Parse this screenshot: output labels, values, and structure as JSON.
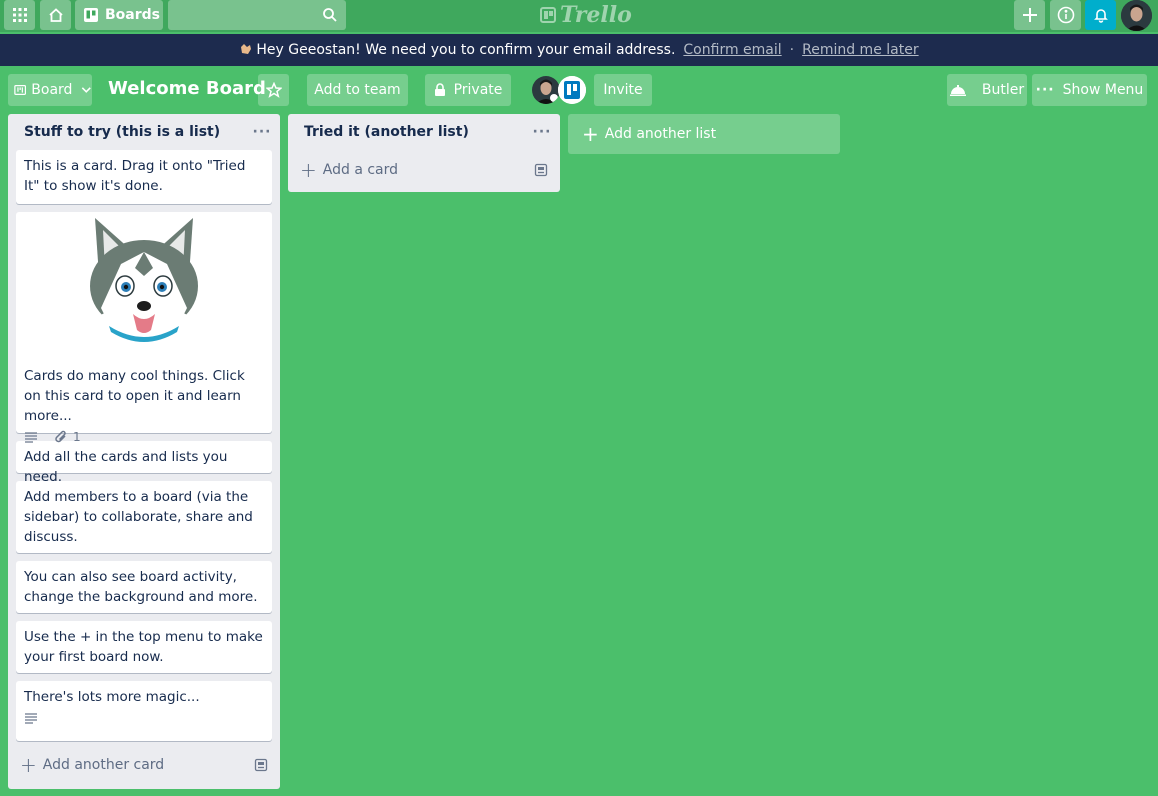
{
  "topbar": {
    "boards_label": "Boards",
    "logo_text": "Trello"
  },
  "banner": {
    "message": "Hey Geeostan! We need you to confirm your email address.",
    "confirm_link": "Confirm email",
    "separator": "·",
    "remind_link": "Remind me later"
  },
  "board_header": {
    "view_label": "Board",
    "title": "Welcome Board",
    "add_to_team": "Add to team",
    "visibility": "Private",
    "invite": "Invite",
    "butler": "Butler",
    "show_menu": "Show Menu"
  },
  "lists": [
    {
      "title": "Stuff to try (this is a list)",
      "menu": "···",
      "add_card": "Add another card",
      "cards": [
        {
          "text": "This is a card. Drag it onto \"Tried It\" to show it's done."
        },
        {
          "text": "Cards do many cool things. Click on this card to open it and learn more...",
          "attachments": "1"
        },
        {
          "text": "Add all the cards and lists you need."
        },
        {
          "text": "Add members to a board (via the sidebar) to collaborate, share and discuss."
        },
        {
          "text": "You can also see board activity, change the background and more."
        },
        {
          "text": "Use the + in the top menu to make your first board now."
        },
        {
          "text": "There's lots more magic..."
        }
      ]
    },
    {
      "title": "Tried it (another list)",
      "menu": "···",
      "add_card": "Add a card",
      "cards": []
    }
  ],
  "add_list": "Add another list",
  "colors": {
    "board_bg": "#4bbf6b",
    "topbar_bg": "#3fa85d",
    "banner_bg": "#1d2b4e",
    "notification_accent": "#00aecc"
  },
  "icons": {
    "apps": "grid-icon",
    "home": "home-icon",
    "boards": "board-icon",
    "search": "search-icon",
    "create": "plus-icon",
    "info": "info-icon",
    "notifications": "bell-icon",
    "butler": "butler-icon",
    "visibility": "lock-icon",
    "star": "star-icon"
  }
}
